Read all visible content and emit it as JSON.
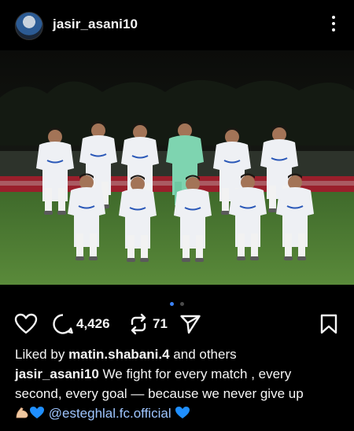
{
  "post": {
    "username": "jasir_asani10",
    "more_icon": "more-vertical-icon",
    "carousel": {
      "count": 2,
      "active": 0,
      "active_color": "#3b82f6",
      "inactive_color": "#4a4a4a"
    }
  },
  "actions": {
    "comments": "4,426",
    "reposts": "71"
  },
  "likes": {
    "prefix": "Liked by",
    "user": "matin.shabani.4",
    "suffix": "and others"
  },
  "caption": {
    "author": "jasir_asani10",
    "line1": "We fight for every match , every",
    "line2": "second, every goal — because we never give up",
    "mention": "@esteghlal.fc.official"
  },
  "colors": {
    "background": "#000000",
    "text": "#f5f5f5",
    "mention": "#9ec5ff",
    "heart_blue": "#1f8fff"
  }
}
